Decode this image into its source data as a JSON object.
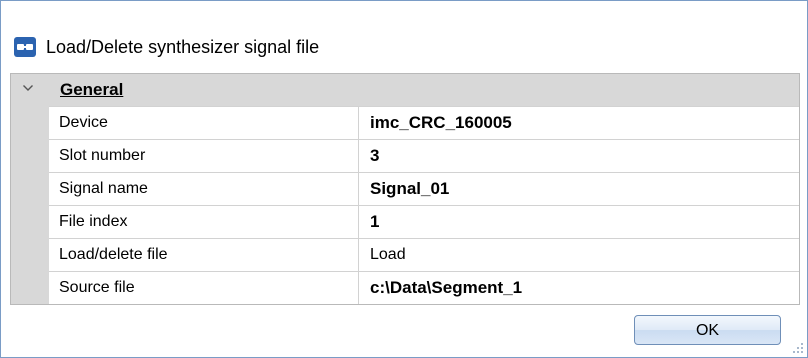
{
  "window": {
    "title": "Load/Delete synthesizer signal file",
    "icon": "synthesizer-icon"
  },
  "grid": {
    "category": {
      "label": "General",
      "state": "expanded",
      "icon": "chevron-down-icon"
    },
    "rows": [
      {
        "name": "Device",
        "value": "imc_CRC_160005",
        "bold": true
      },
      {
        "name": "Slot number",
        "value": "3",
        "bold": true
      },
      {
        "name": "Signal name",
        "value": "Signal_01",
        "bold": true
      },
      {
        "name": "File index",
        "value": "1",
        "bold": true
      },
      {
        "name": "Load/delete file",
        "value": "Load",
        "bold": false
      },
      {
        "name": "Source file",
        "value": "c:\\Data\\Segment_1",
        "bold": true
      }
    ]
  },
  "buttons": {
    "ok_label": "OK"
  },
  "colors": {
    "frame_border": "#7a9cc6",
    "category_background": "#d8d8d8",
    "grid_line": "#d2d2d2",
    "icon_blue": "#2b63b0"
  }
}
